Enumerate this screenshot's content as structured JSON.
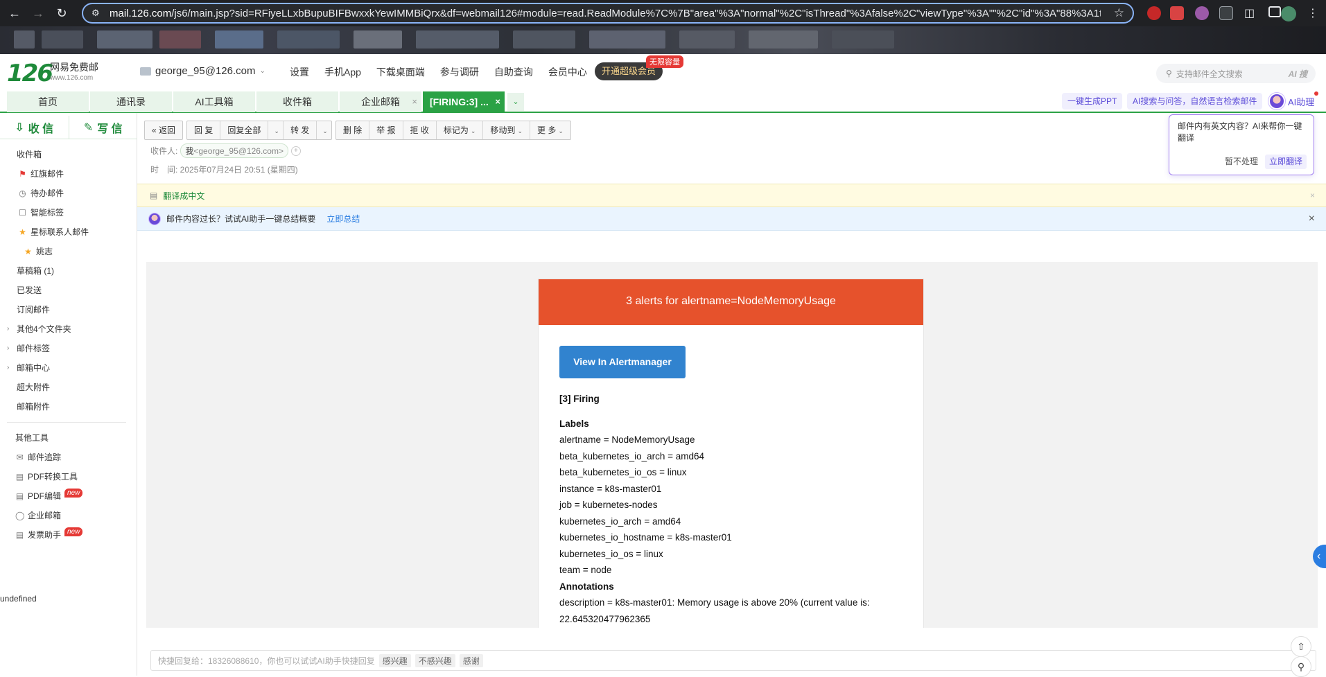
{
  "browser": {
    "url_host": "mail.126.com",
    "url_rest": "/js6/main.jsp?sid=RFiyeLLxbBupuBIFBwxxkYewIMMBiQrx&df=webmail126#module=read.ReadModule%7C%7B\"area\"%3A\"normal\"%2C\"isThread\"%3Afalse%2C\"viewType\"%3A\"\"%2C\"id\"%3A\"88%3A1t..."
  },
  "header": {
    "logo_num": "126",
    "logo_text": "网易免费邮",
    "logo_sub": "www.126.com",
    "account": "george_95@126.com",
    "nav": [
      "设置",
      "手机App",
      "下载桌面端",
      "参与调研",
      "自助查询",
      "会员中心"
    ],
    "vip_label": "开通超级会员",
    "vip_tag": "无限容量",
    "search_placeholder": "支持邮件全文搜索",
    "search_ai": "AI 搜"
  },
  "tabs": {
    "items": [
      "首页",
      "通讯录",
      "AI工具箱",
      "收件箱",
      "企业邮箱",
      "[FIRING:3] ..."
    ],
    "right_buttons": [
      "一键生成PPT",
      "AI搜索与问答，自然语言检索邮件"
    ],
    "ai_help": "AI助理"
  },
  "sidebar": {
    "receive": "收 信",
    "write": "写 信",
    "folders": {
      "inbox": "收件箱",
      "flagged": "红旗邮件",
      "todo": "待办邮件",
      "smart": "智能标签",
      "star_contacts": "星标联系人邮件",
      "yao": "姚志",
      "drafts": "草稿箱 (1)",
      "sent": "已发送",
      "subs": "订阅邮件",
      "other4": "其他4个文件夹",
      "labels": "邮件标签",
      "center": "邮箱中心",
      "bigatt": "超大附件",
      "att": "邮箱附件"
    },
    "tools": {
      "title": "其他工具",
      "track": "邮件追踪",
      "pdfconv": "PDF转换工具",
      "pdfedit": "PDF编辑",
      "ent": "企业邮箱",
      "invoice": "发票助手",
      "new": "new"
    },
    "undefined_text": "undefined"
  },
  "toolbar": {
    "back": "返回",
    "reply": "回 复",
    "reply_all": "回复全部",
    "forward": "转 发",
    "delete": "删 除",
    "report": "举 报",
    "reject": "拒 收",
    "mark_as": "标记为",
    "move_to": "移动到",
    "more": "更 多"
  },
  "meta": {
    "recv_label": "收件人:",
    "recv_me": "我",
    "recv_addr": "<george_95@126.com>",
    "time": "时　间: 2025年07月24日 20:51 (星期四)"
  },
  "banners": {
    "translate": "翻译成中文",
    "ai_tip": "邮件内容过长？试试AI助手一键总结概要",
    "ai_link": "立即总结"
  },
  "popover": {
    "text": "邮件内有英文内容？AI来帮你一键翻译",
    "later": "暂不处理",
    "now": "立即翻译"
  },
  "email": {
    "header": "3 alerts for alertname=NodeMemoryUsage",
    "button": "View In Alertmanager",
    "firing": "[3] Firing",
    "labels_title": "Labels",
    "labels": [
      "alertname = NodeMemoryUsage",
      "beta_kubernetes_io_arch = amd64",
      "beta_kubernetes_io_os = linux",
      "instance = k8s-master01",
      "job = kubernetes-nodes",
      "kubernetes_io_arch = amd64",
      "kubernetes_io_hostname = k8s-master01",
      "kubernetes_io_os = linux",
      "team = node"
    ],
    "annotations_title": "Annotations",
    "description": "description = k8s-master01: Memory usage is above 20% (current value is:",
    "description_value": "22.645320477962365"
  },
  "quick_reply": {
    "placeholder": "快捷回复给：18326088610，你也可以试试AI助手快捷回复",
    "chips": [
      "感兴趣",
      "不感兴趣",
      "感谢"
    ]
  }
}
